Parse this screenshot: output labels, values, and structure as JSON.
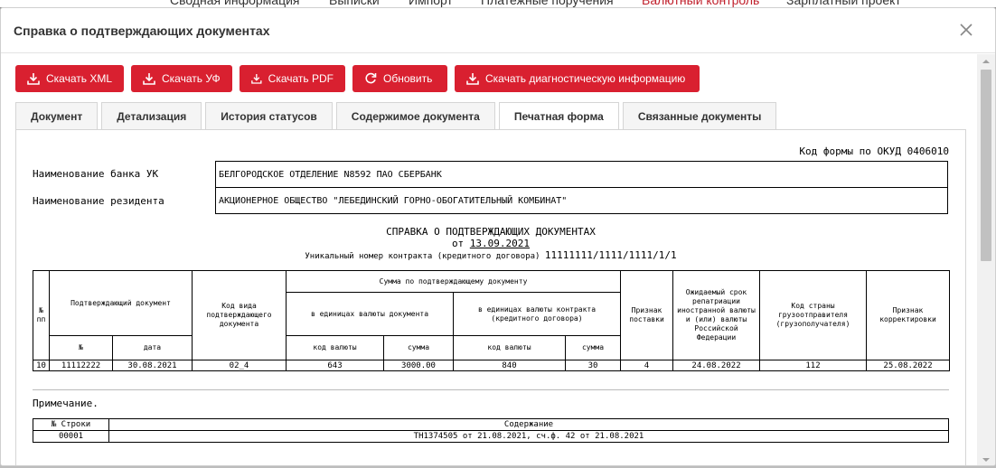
{
  "background": {
    "nav_items": [
      "Сводная информация",
      "Выписки",
      "Импорт",
      "Платежные поручения",
      "Валютный контроль",
      "Зарплатный проект"
    ]
  },
  "modal": {
    "title": "Справка о подтверждающих документах"
  },
  "buttons": {
    "xml": "Скачать XML",
    "uf": "Скачать УФ",
    "pdf": "Скачать PDF",
    "refresh": "Обновить",
    "diag": "Скачать диагностическую информацию"
  },
  "tabs": [
    "Документ",
    "Детализация",
    "История статусов",
    "Содержимое документа",
    "Печатная форма",
    "Связанные документы"
  ],
  "active_tab": "Печатная форма",
  "doc": {
    "okud": "Код формы по ОКУД 0406010",
    "bank_label": "Наименование банка УК",
    "bank_value": "БЕЛГОРОДСКОЕ ОТДЕЛЕНИЕ N8592 ПАО СБЕРБАНК",
    "resident_label": "Наименование резидента",
    "resident_value": "АКЦИОНЕРНОЕ ОБЩЕСТВО \"ЛЕБЕДИНСКИЙ ГОРНО-ОБОГАТИТЕЛЬНЫЙ КОМБИНАТ\"",
    "title": "СПРАВКА О ПОДТВЕРЖДАЮЩИХ ДОКУМЕНТАХ",
    "date_prefix": "от",
    "date": "13.09.2021",
    "contract_label": "Уникальный номер контракта (кредитного договора)",
    "contract_number": "11111111/1111/1111/1/1",
    "headers": {
      "num": "№ пп",
      "confirming_doc": "Подтверждающий документ",
      "doc_no": "№",
      "doc_date": "дата",
      "doc_kind": "Код вида подтверждающего документа",
      "sum_by_doc": "Сумма по подтверждающему документу",
      "in_doc_currency": "в единицах валюты документа",
      "in_contract_currency": "в единицах валюты контракта (кредитного договора)",
      "currency_code": "код валюты",
      "amount": "сумма",
      "currency_code_2": "код валюты",
      "amount_2": "сумма",
      "supply_sign": "Признак поставки",
      "expected_term": "Ожидаемый срок репатриации иностранной валюты и (или) валюты Российской Федерации",
      "country_code": "Код страны грузоотправителя (грузополучателя)",
      "correction_sign": "Признак корректировки"
    },
    "rows": [
      {
        "num": "10",
        "doc_no": "11112222",
        "doc_date": "30.08.2021",
        "doc_kind": "02_4",
        "cur_code": "643",
        "amount": "3000.00",
        "contract_cur_code": "840",
        "contract_amount": "30",
        "supply": "4",
        "expected": "24.08.2022",
        "country": "112",
        "correction": "25.08.2022"
      }
    ],
    "note_label": "Примечание.",
    "notes_headers": {
      "line": "№ Строки",
      "content": "Содержание"
    },
    "notes_rows": [
      {
        "line": "00001",
        "content": "ТН1374505 от 21.08.2021, сч.ф. 42 от 21.08.2021"
      }
    ]
  }
}
